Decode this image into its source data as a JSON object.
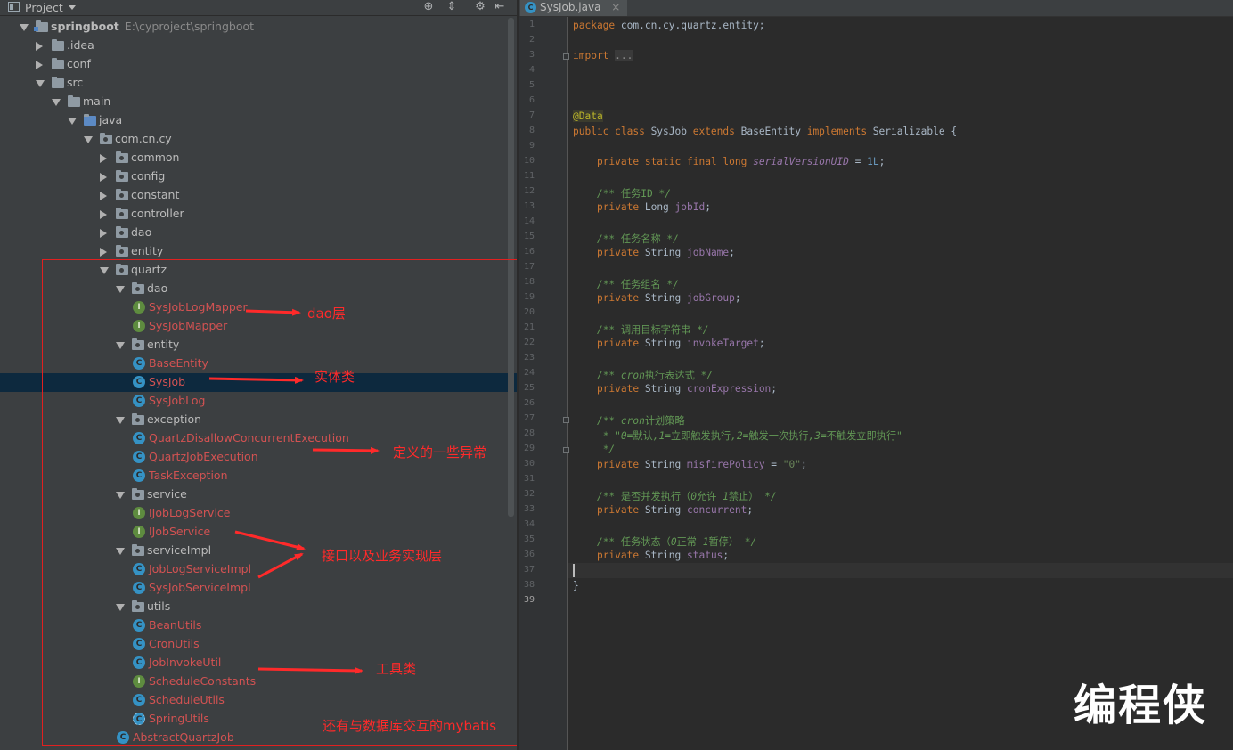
{
  "project_panel": {
    "title": "Project",
    "root": {
      "name": "springboot",
      "path": "E:\\cyproject\\springboot"
    },
    "tree": [
      {
        "label": "springboot",
        "kind": "module",
        "expanded": true,
        "level": 0
      },
      {
        "label": ".idea",
        "kind": "folder",
        "expanded": false,
        "level": 1
      },
      {
        "label": "conf",
        "kind": "folder",
        "expanded": false,
        "level": 1
      },
      {
        "label": "src",
        "kind": "folder",
        "expanded": true,
        "level": 1
      },
      {
        "label": "main",
        "kind": "folder",
        "expanded": true,
        "level": 2
      },
      {
        "label": "java",
        "kind": "folder-src",
        "expanded": true,
        "level": 3
      },
      {
        "label": "com.cn.cy",
        "kind": "package",
        "expanded": true,
        "level": 4
      },
      {
        "label": "common",
        "kind": "package",
        "expanded": false,
        "level": 5
      },
      {
        "label": "config",
        "kind": "package",
        "expanded": false,
        "level": 5
      },
      {
        "label": "constant",
        "kind": "package",
        "expanded": false,
        "level": 5
      },
      {
        "label": "controller",
        "kind": "package",
        "expanded": false,
        "level": 5
      },
      {
        "label": "dao",
        "kind": "package",
        "expanded": false,
        "level": 5
      },
      {
        "label": "entity",
        "kind": "package",
        "expanded": false,
        "level": 5
      },
      {
        "label": "quartz",
        "kind": "package",
        "expanded": true,
        "level": 5
      },
      {
        "label": "dao",
        "kind": "package",
        "expanded": true,
        "level": 6
      },
      {
        "label": "SysJobLogMapper",
        "kind": "interface",
        "level": 7
      },
      {
        "label": "SysJobMapper",
        "kind": "interface",
        "level": 7
      },
      {
        "label": "entity",
        "kind": "package",
        "expanded": true,
        "level": 6
      },
      {
        "label": "BaseEntity",
        "kind": "class",
        "level": 7
      },
      {
        "label": "SysJob",
        "kind": "class",
        "level": 7,
        "selected": true
      },
      {
        "label": "SysJobLog",
        "kind": "class",
        "level": 7
      },
      {
        "label": "exception",
        "kind": "package",
        "expanded": true,
        "level": 6
      },
      {
        "label": "QuartzDisallowConcurrentExecution",
        "kind": "class",
        "level": 7
      },
      {
        "label": "QuartzJobExecution",
        "kind": "class",
        "level": 7
      },
      {
        "label": "TaskException",
        "kind": "class",
        "level": 7
      },
      {
        "label": "service",
        "kind": "package",
        "expanded": true,
        "level": 6
      },
      {
        "label": "IJobLogService",
        "kind": "interface",
        "level": 7
      },
      {
        "label": "IJobService",
        "kind": "interface",
        "level": 7
      },
      {
        "label": "serviceImpl",
        "kind": "package",
        "expanded": true,
        "level": 6
      },
      {
        "label": "JobLogServiceImpl",
        "kind": "class",
        "level": 7
      },
      {
        "label": "SysJobServiceImpl",
        "kind": "class",
        "level": 7
      },
      {
        "label": "utils",
        "kind": "package",
        "expanded": true,
        "level": 6
      },
      {
        "label": "BeanUtils",
        "kind": "class",
        "level": 7
      },
      {
        "label": "CronUtils",
        "kind": "class",
        "level": 7
      },
      {
        "label": "JobInvokeUtil",
        "kind": "class",
        "level": 7
      },
      {
        "label": "ScheduleConstants",
        "kind": "interface",
        "level": 7
      },
      {
        "label": "ScheduleUtils",
        "kind": "class",
        "level": 7
      },
      {
        "label": "SpringUtils",
        "kind": "class-special",
        "level": 7
      },
      {
        "label": "AbstractQuartzJob",
        "kind": "class-abstract",
        "level": 6
      }
    ]
  },
  "annotations": {
    "dao": "dao层",
    "entity": "实体类",
    "exception": "定义的一些异常",
    "service": "接口以及业务实现层",
    "utils": "工具类",
    "mybatis": "还有与数据库交互的mybatis",
    "color": "#ff2a2a"
  },
  "editor": {
    "tab": {
      "label": "SysJob.java",
      "close": "×"
    },
    "caret_line": 39,
    "lines": [
      [
        [
          "kw",
          "package"
        ],
        [
          "t",
          " com.cn.cy.quartz.entity;"
        ]
      ],
      [],
      [
        [
          "kw",
          "import"
        ],
        [
          "t",
          " "
        ],
        [
          "fold",
          "..."
        ]
      ],
      [],
      [],
      [],
      [
        [
          "ann",
          "@Data"
        ]
      ],
      [
        [
          "kw",
          "public class"
        ],
        [
          "t",
          " SysJob "
        ],
        [
          "kw",
          "extends"
        ],
        [
          "t",
          " BaseEntity "
        ],
        [
          "kw",
          "implements"
        ],
        [
          "t",
          " Serializable {"
        ]
      ],
      [],
      [
        [
          "t",
          "    "
        ],
        [
          "kw",
          "private static final long"
        ],
        [
          "t",
          " "
        ],
        [
          "field-i",
          "serialVersionUID"
        ],
        [
          "t",
          " = "
        ],
        [
          "num",
          "1L"
        ],
        [
          "t",
          ";"
        ]
      ],
      [],
      [
        [
          "t",
          "    "
        ],
        [
          "cmt",
          "/** "
        ],
        [
          "cmtc",
          "任务ID"
        ],
        [
          "cmt",
          " */"
        ]
      ],
      [
        [
          "t",
          "    "
        ],
        [
          "kw",
          "private"
        ],
        [
          "t",
          " Long "
        ],
        [
          "field",
          "jobId"
        ],
        [
          "t",
          ";"
        ]
      ],
      [],
      [
        [
          "t",
          "    "
        ],
        [
          "cmt",
          "/** "
        ],
        [
          "cmtc",
          "任务名称"
        ],
        [
          "cmt",
          " */"
        ]
      ],
      [
        [
          "t",
          "    "
        ],
        [
          "kw",
          "private"
        ],
        [
          "t",
          " String "
        ],
        [
          "field",
          "jobName"
        ],
        [
          "t",
          ";"
        ]
      ],
      [],
      [
        [
          "t",
          "    "
        ],
        [
          "cmt",
          "/** "
        ],
        [
          "cmtc",
          "任务组名"
        ],
        [
          "cmt",
          " */"
        ]
      ],
      [
        [
          "t",
          "    "
        ],
        [
          "kw",
          "private"
        ],
        [
          "t",
          " String "
        ],
        [
          "field",
          "jobGroup"
        ],
        [
          "t",
          ";"
        ]
      ],
      [],
      [
        [
          "t",
          "    "
        ],
        [
          "cmt",
          "/** "
        ],
        [
          "cmtc",
          "调用目标字符串"
        ],
        [
          "cmt",
          " */"
        ]
      ],
      [
        [
          "t",
          "    "
        ],
        [
          "kw",
          "private"
        ],
        [
          "t",
          " String "
        ],
        [
          "field",
          "invokeTarget"
        ],
        [
          "t",
          ";"
        ]
      ],
      [],
      [
        [
          "t",
          "    "
        ],
        [
          "cmt",
          "/** cron"
        ],
        [
          "cmtc",
          "执行表达式"
        ],
        [
          "cmt",
          " */"
        ]
      ],
      [
        [
          "t",
          "    "
        ],
        [
          "kw",
          "private"
        ],
        [
          "t",
          " String "
        ],
        [
          "field",
          "cronExpression"
        ],
        [
          "t",
          ";"
        ]
      ],
      [],
      [
        [
          "t",
          "    "
        ],
        [
          "cmt",
          "/** cron"
        ],
        [
          "cmtc",
          "计划策略"
        ]
      ],
      [
        [
          "t",
          "     "
        ],
        [
          "cmt",
          "* \"0="
        ],
        [
          "cmtc",
          "默认"
        ],
        [
          "cmt",
          ",1="
        ],
        [
          "cmtc",
          "立即触发执行"
        ],
        [
          "cmt",
          ",2="
        ],
        [
          "cmtc",
          "触发一次执行"
        ],
        [
          "cmt",
          ",3="
        ],
        [
          "cmtc",
          "不触发立即执行"
        ],
        [
          "cmt",
          "\""
        ]
      ],
      [
        [
          "t",
          "     "
        ],
        [
          "cmt",
          "*/"
        ]
      ],
      [
        [
          "t",
          "    "
        ],
        [
          "kw",
          "private"
        ],
        [
          "t",
          " String "
        ],
        [
          "field",
          "misfirePolicy"
        ],
        [
          "t",
          " = "
        ],
        [
          "str",
          "\"0\""
        ],
        [
          "t",
          ";"
        ]
      ],
      [],
      [
        [
          "t",
          "    "
        ],
        [
          "cmt",
          "/** "
        ],
        [
          "cmtc",
          "是否并发执行（"
        ],
        [
          "cmt",
          "0"
        ],
        [
          "cmtc",
          "允许 "
        ],
        [
          "cmt",
          "1"
        ],
        [
          "cmtc",
          "禁止）"
        ],
        [
          "cmt",
          " */"
        ]
      ],
      [
        [
          "t",
          "    "
        ],
        [
          "kw",
          "private"
        ],
        [
          "t",
          " String "
        ],
        [
          "field",
          "concurrent"
        ],
        [
          "t",
          ";"
        ]
      ],
      [],
      [
        [
          "t",
          "    "
        ],
        [
          "cmt",
          "/** "
        ],
        [
          "cmtc",
          "任务状态（"
        ],
        [
          "cmt",
          "0"
        ],
        [
          "cmtc",
          "正常 "
        ],
        [
          "cmt",
          "1"
        ],
        [
          "cmtc",
          "暂停）"
        ],
        [
          "cmt",
          " */"
        ]
      ],
      [
        [
          "t",
          "    "
        ],
        [
          "kw",
          "private"
        ],
        [
          "t",
          " String "
        ],
        [
          "field",
          "status"
        ],
        [
          "t",
          ";"
        ]
      ],
      [],
      [
        [
          "t",
          "}"
        ]
      ],
      []
    ]
  },
  "watermark": "编程侠"
}
